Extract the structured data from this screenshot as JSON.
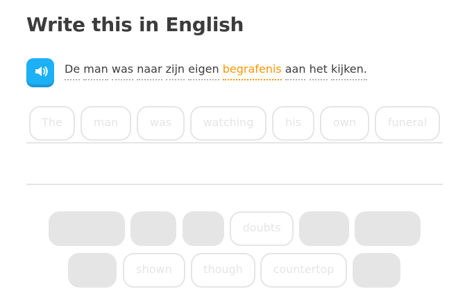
{
  "prompt": {
    "title": "Write this in English"
  },
  "sentence": {
    "words": [
      "De",
      "man",
      "was",
      "naar",
      "zijn",
      "eigen",
      "begrafenis",
      "aan",
      "het",
      "kijken."
    ],
    "new_word": "begrafenis"
  },
  "answer_area": {
    "placeholder_words": [
      "The",
      "man",
      "was",
      "watching",
      "his",
      "own",
      "funeral"
    ]
  },
  "word_bank": {
    "row1": [
      "",
      "",
      "",
      "doubts",
      "",
      ""
    ],
    "row2": [
      "",
      "shown",
      "though",
      "countertop",
      ""
    ]
  },
  "colors": {
    "accent": "#1cb0f6",
    "new_word": "#ff9600",
    "chip_border": "#e5e5e5"
  },
  "icons": {
    "audio": "speaker-icon"
  }
}
